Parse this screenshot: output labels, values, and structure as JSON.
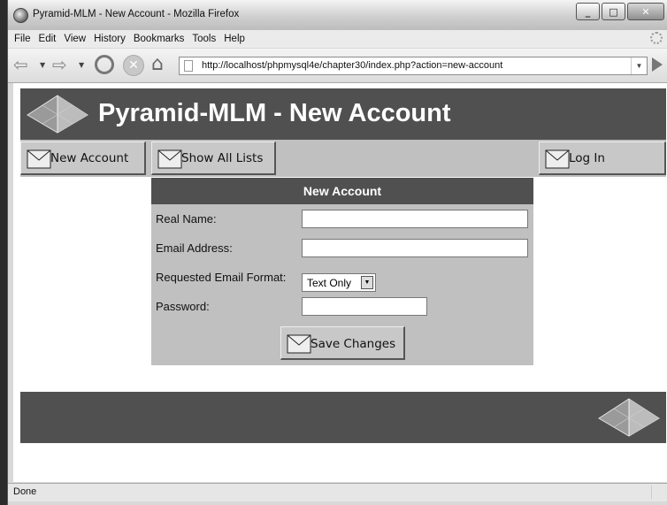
{
  "window": {
    "title": "Pyramid-MLM - New Account - Mozilla Firefox"
  },
  "menu": [
    "File",
    "Edit",
    "View",
    "History",
    "Bookmarks",
    "Tools",
    "Help"
  ],
  "address": {
    "url": "http://localhost/phpmysql4e/chapter30/index.php?action=new-account"
  },
  "page": {
    "heading": "Pyramid-MLM - New Account",
    "nav": {
      "new_account": "New Account",
      "show_all_lists": "Show All Lists",
      "log_in": "Log In"
    },
    "form": {
      "title": "New Account",
      "real_name_label": "Real Name:",
      "email_label": "Email Address:",
      "format_label": "Requested Email Format:",
      "format_value": "Text Only",
      "password_label": "Password:",
      "real_name_value": "",
      "email_value": "",
      "password_value": "",
      "save_label": "Save Changes"
    }
  },
  "status": {
    "text": "Done"
  },
  "icons": [
    "firefox-icon",
    "back-icon",
    "forward-icon",
    "reload-icon",
    "stop-icon",
    "home-icon",
    "page-icon",
    "envelope-icon",
    "pyramid-icon"
  ]
}
